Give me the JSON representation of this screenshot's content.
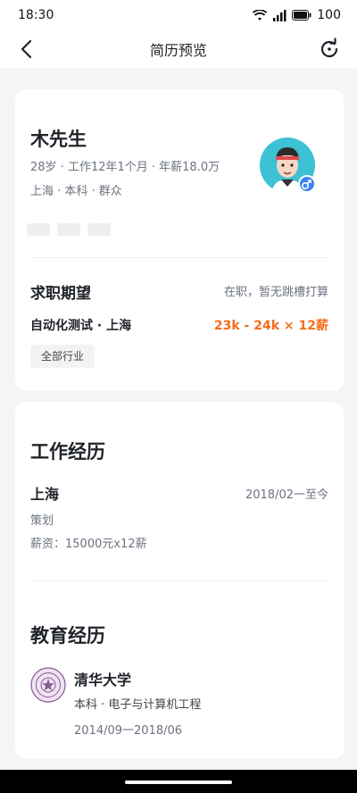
{
  "status_bar": {
    "time": "18:30",
    "battery": "100"
  },
  "nav": {
    "title": "简历预览",
    "back_icon": "chevron-left-icon",
    "refresh_icon": "refresh-icon"
  },
  "profile": {
    "name": "木先生",
    "meta_line1": "28岁 · 工作12年1个月 · 年薪18.0万",
    "meta_line2": "上海 · 本科 · 群众",
    "gender_icon": "male-icon"
  },
  "job_expectation": {
    "title": "求职期望",
    "status": "在职，暂无跳槽打算",
    "position": "自动化测试 · 上海",
    "salary": "23k - 24k × 12薪",
    "industry": "全部行业"
  },
  "work": {
    "title": "工作经历",
    "company": "上海",
    "date": "2018/02一至今",
    "role": "策划",
    "salary": "薪资：15000元x12薪"
  },
  "education": {
    "title": "教育经历",
    "school": "清华大学",
    "major": "本科 · 电子与计算机工程",
    "date": "2014/09一2018/06"
  },
  "colors": {
    "accent_salary": "#f56c1b",
    "avatar_bg": "#3cc2d4",
    "male_badge": "#3b82f6"
  }
}
